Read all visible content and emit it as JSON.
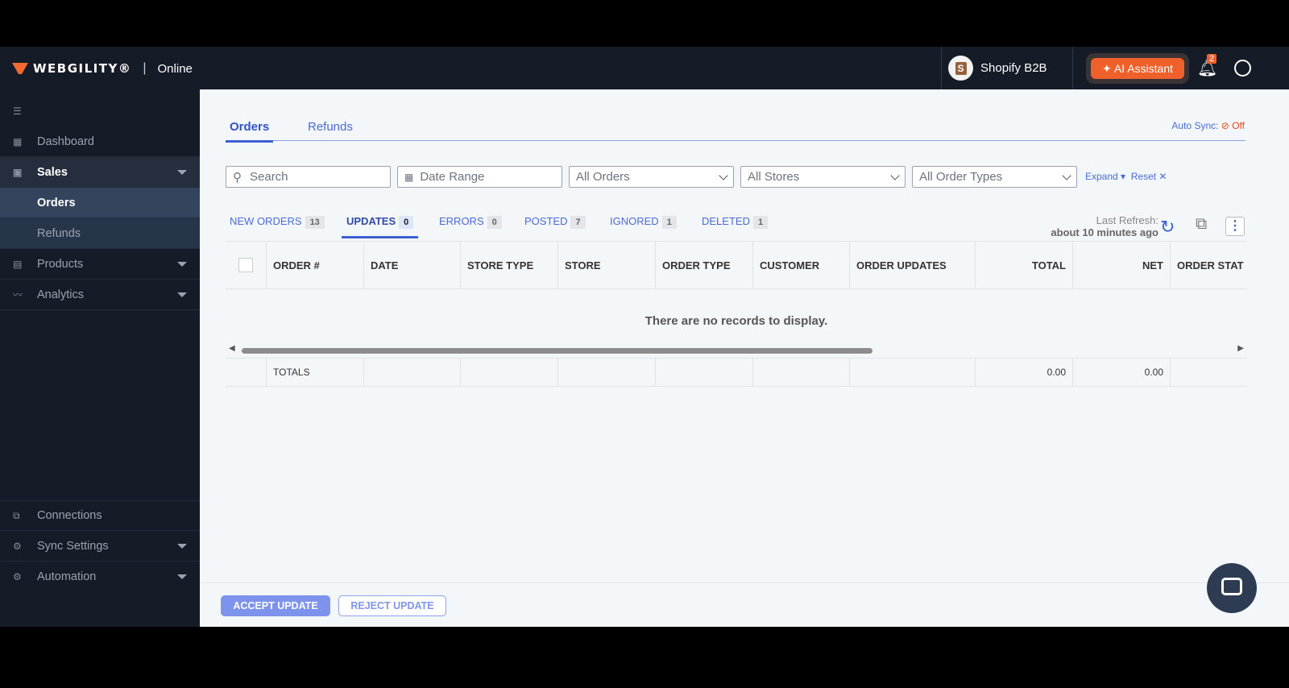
{
  "header": {
    "brand": "WEBGILITY®",
    "product": "Online",
    "store": "Shopify B2B",
    "ai_label": "AI Assistant",
    "notifications": "2"
  },
  "sidebar": {
    "items": [
      {
        "label": "Dashboard"
      },
      {
        "label": "Sales"
      },
      {
        "label": "Orders"
      },
      {
        "label": "Refunds"
      },
      {
        "label": "Products"
      },
      {
        "label": "Analytics"
      },
      {
        "label": "Connections"
      },
      {
        "label": "Sync Settings"
      },
      {
        "label": "Automation"
      }
    ]
  },
  "tabs": [
    "Orders",
    "Refunds"
  ],
  "autosync": {
    "label": "Auto Sync:",
    "value": "Off"
  },
  "filters": {
    "search": "Search",
    "date": "Date Range",
    "orders": "All Orders",
    "stores": "All Stores",
    "types": "All Order Types",
    "expand": "Expand",
    "reset": "Reset"
  },
  "status_tabs": [
    {
      "label": "NEW ORDERS",
      "count": "13"
    },
    {
      "label": "UPDATES",
      "count": "0"
    },
    {
      "label": "ERRORS",
      "count": "0"
    },
    {
      "label": "POSTED",
      "count": "7"
    },
    {
      "label": "IGNORED",
      "count": "1"
    },
    {
      "label": "DELETED",
      "count": "1"
    }
  ],
  "refresh": {
    "label": "Last Refresh:",
    "value": "about 10 minutes ago"
  },
  "columns": [
    "ORDER #",
    "DATE",
    "STORE TYPE",
    "STORE",
    "ORDER TYPE",
    "CUSTOMER",
    "ORDER UPDATES",
    "TOTAL",
    "NET",
    "ORDER STAT"
  ],
  "empty": "There are no records to display.",
  "totals": {
    "label": "TOTALS",
    "total": "0.00",
    "net": "0.00"
  },
  "footer": {
    "accept": "ACCEPT UPDATE",
    "reject": "REJECT UPDATE"
  }
}
